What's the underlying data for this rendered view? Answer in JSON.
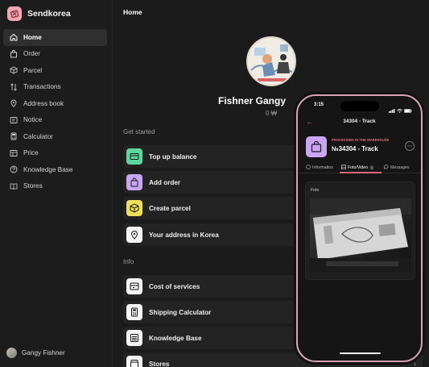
{
  "brand": {
    "name": "Sendkorea"
  },
  "sidebar": {
    "items": [
      {
        "label": "Home",
        "icon": "home-icon",
        "active": true
      },
      {
        "label": "Order",
        "icon": "bag-icon"
      },
      {
        "label": "Parcel",
        "icon": "box-icon"
      },
      {
        "label": "Transactions",
        "icon": "transfer-icon"
      },
      {
        "label": "Address book",
        "icon": "pin-icon"
      },
      {
        "label": "Notice",
        "icon": "notice-icon"
      },
      {
        "label": "Calculator",
        "icon": "calculator-icon"
      },
      {
        "label": "Price",
        "icon": "price-icon"
      },
      {
        "label": "Knowledge Base",
        "icon": "help-icon"
      },
      {
        "label": "Stores",
        "icon": "book-icon"
      }
    ],
    "user_name": "Gangy Fishner"
  },
  "main": {
    "title": "Home",
    "profile": {
      "name": "Fishner Gangy",
      "balance": "0 ₩"
    },
    "get_started_label": "Get started",
    "get_started": [
      {
        "label": "Top up balance",
        "icon": "card-icon",
        "color": "#5dd7a0"
      },
      {
        "label": "Add order",
        "icon": "bag-icon",
        "color": "#c9a5f3"
      },
      {
        "label": "Create parcel",
        "icon": "box-icon",
        "color": "#f0df5a"
      },
      {
        "label": "Your address in Korea",
        "icon": "pin-icon",
        "color": "#f4f4f4"
      }
    ],
    "info_label": "Info",
    "info": [
      {
        "label": "Cost of services",
        "icon": "wallet-icon"
      },
      {
        "label": "Shipping Calculator",
        "icon": "calculator-icon"
      },
      {
        "label": "Knowledge Base",
        "icon": "list-icon"
      },
      {
        "label": "Stores",
        "icon": "store-icon"
      }
    ]
  },
  "phone": {
    "time": "3:15",
    "header_title": "34304 - Track",
    "order_status": "PROCESSING IN THE WAREHOUSE",
    "order_number": "№34304 - Track",
    "tabs": [
      {
        "label": "Information"
      },
      {
        "label": "Foto/Video",
        "badge": "1",
        "active": true
      },
      {
        "label": "Messages"
      }
    ],
    "foto_label": "Foto",
    "accent_color": "#e66a7a"
  }
}
